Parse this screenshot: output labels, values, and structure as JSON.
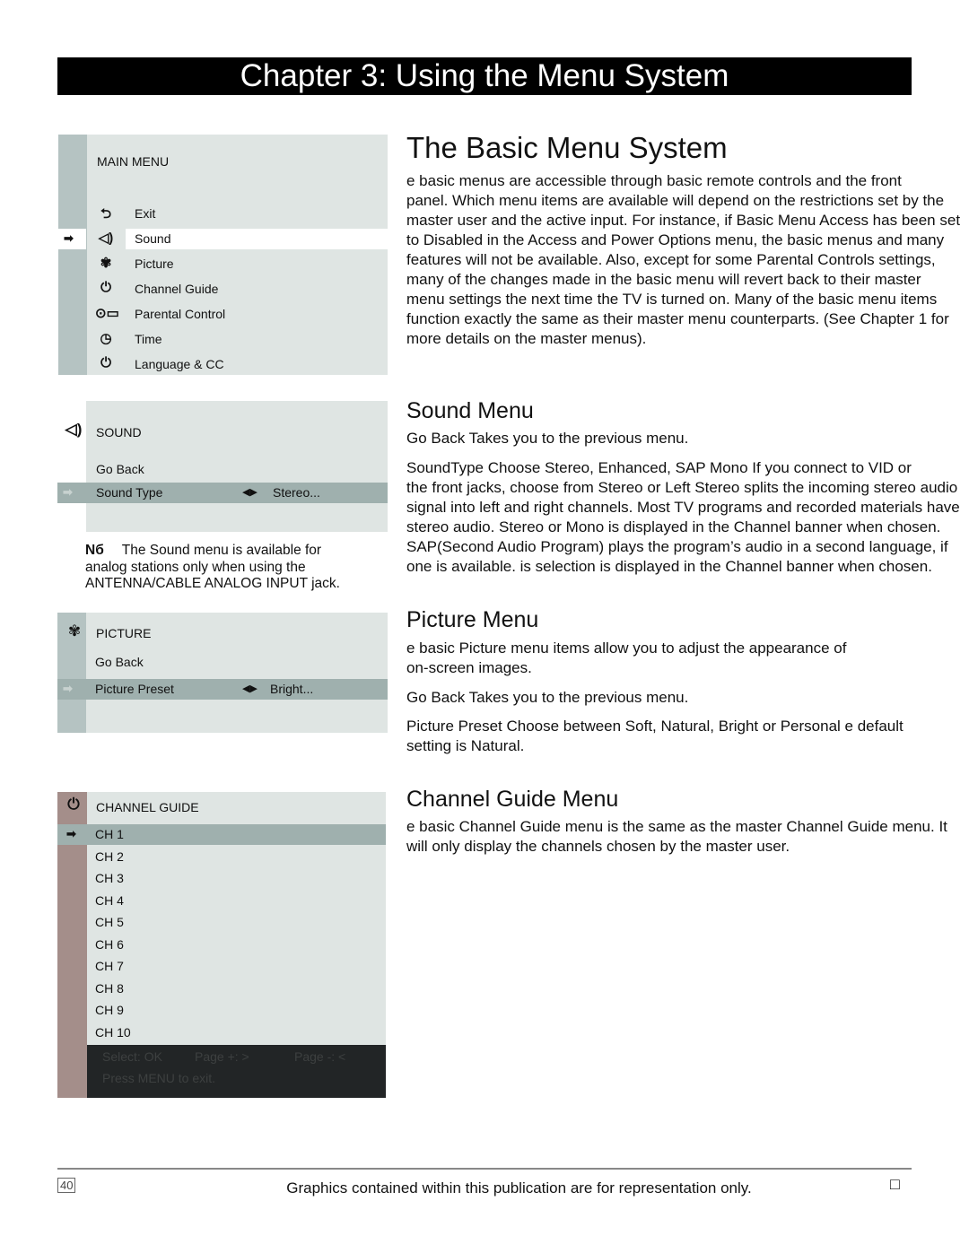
{
  "header": {
    "title": "Chapter 3: Using the Menu System"
  },
  "main_menu": {
    "title": "MAIN MENU",
    "items": [
      {
        "label": "Exit",
        "icon": "exit-arrow-icon",
        "glyph": "⮌"
      },
      {
        "label": "Sound",
        "icon": "speaker-icon",
        "glyph": "◁)",
        "selected": true
      },
      {
        "label": "Picture",
        "icon": "butterfly-icon",
        "glyph": "✾"
      },
      {
        "label": "Channel Guide",
        "icon": "plug-icon",
        "glyph": "⏻"
      },
      {
        "label": "Parental Control",
        "icon": "key-icon",
        "glyph": "⊙▭"
      },
      {
        "label": "Time",
        "icon": "clock-icon",
        "glyph": "◷"
      },
      {
        "label": "Language & CC",
        "icon": "plug-icon",
        "glyph": "⏻"
      }
    ],
    "pointer": "➡"
  },
  "sound_menu": {
    "title": "SOUND",
    "items": [
      {
        "label": "Go Back"
      },
      {
        "label": "Sound Type",
        "value": "Stereo...",
        "selected": true
      }
    ],
    "arrows": "◀▶"
  },
  "note": {
    "label": "Nб",
    "lines": [
      "The Sound menu is available for",
      "analog stations only when using the",
      "ANTENNA/CABLE ANALOG INPUT jack."
    ]
  },
  "picture_menu": {
    "title": "PICTURE",
    "items": [
      {
        "label": "Go Back"
      },
      {
        "label": "Picture Preset",
        "value": "Bright...",
        "selected": true
      }
    ],
    "arrows": "◀▶"
  },
  "channel_guide_menu": {
    "title": "CHANNEL GUIDE",
    "channels": [
      "CH 1",
      "CH 2",
      "CH 3",
      "CH 4",
      "CH 5",
      "CH 6",
      "CH 7",
      "CH 8",
      "CH 9",
      "CH 10"
    ],
    "footer": {
      "select": "Select: OK",
      "page_plus": "Page +: >",
      "page_minus": "Page -: <",
      "exit": "Press MENU to exit."
    }
  },
  "basic": {
    "title": "The Basic Menu System",
    "lines": [
      " e basic menus are accessible through basic remote controls and the front",
      "panel. Which menu items are available will depend on the restrictions set by the",
      "master user and the active input. For instance, if Basic Menu Access has been set",
      "to Disabled in the Access and Power Options menu, the basic menus and many",
      "features will not be available. Also, except for some Parental Controls settings,",
      "many of the changes made in the basic menu will revert back to their master",
      "menu settings the next time the TV is turned on. Many of the basic menu items",
      "function exactly the same as their master menu counterparts. (See Chapter 1 for",
      "more details on the master menus)."
    ]
  },
  "sound": {
    "title": "Sound Menu",
    "goback": "Go Back   Takes you to the previous menu.",
    "lines": [
      "SoundType   Choose Stereo, Enhanced, SAP Mono If you connect to VID or",
      "the front jacks, choose from Stereo or Left Stereo splits the incoming stereo audio",
      "signal into left and right channels. Most TV programs and recorded materials have",
      "stereo audio. Stereo or Mono is displayed in the Channel banner when chosen.",
      "SAP(Second Audio Program) plays the program’s audio in a second language, if",
      "one is available.  is selection is displayed in the Channel banner when chosen."
    ]
  },
  "picture": {
    "title": "Picture Menu",
    "lines": [
      " e basic  Picture menu items allow you to adjust the appearance of",
      "on-screen images."
    ],
    "goback": "Go Back   Takes you to the previous menu.",
    "preset_lines": [
      "Picture Preset  Choose between Soft, Natural, Bright or Personal e default",
      "setting is Natural."
    ]
  },
  "channel_guide": {
    "title": "Channel Guide Menu",
    "lines": [
      " e basic  Channel Guide menu is the same as the master Channel Guide menu. It",
      "will only display the channels chosen by the master user."
    ]
  },
  "footer": {
    "text": "Graphics contained within this publication are for representation only.",
    "page_left": "40",
    "page_right": "□"
  }
}
